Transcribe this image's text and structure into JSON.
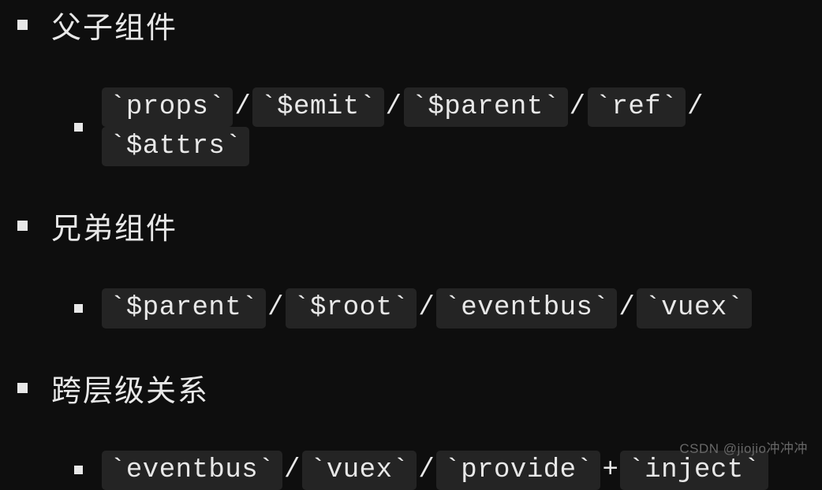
{
  "sections": [
    {
      "heading": "父子组件",
      "code": {
        "segments": [
          "props",
          "$emit",
          "$parent",
          "ref",
          "$attrs"
        ],
        "separators": [
          "/",
          "/",
          "/",
          "/"
        ]
      }
    },
    {
      "heading": "兄弟组件",
      "code": {
        "segments": [
          "$parent",
          "$root",
          "eventbus",
          "vuex"
        ],
        "separators": [
          "/",
          "/",
          "/"
        ]
      }
    },
    {
      "heading": "跨层级关系",
      "code": {
        "segments": [
          "eventbus",
          "vuex",
          "provide",
          "inject"
        ],
        "separators": [
          "/",
          "/",
          "+"
        ]
      }
    }
  ],
  "watermark": "CSDN @jiojio冲冲冲"
}
